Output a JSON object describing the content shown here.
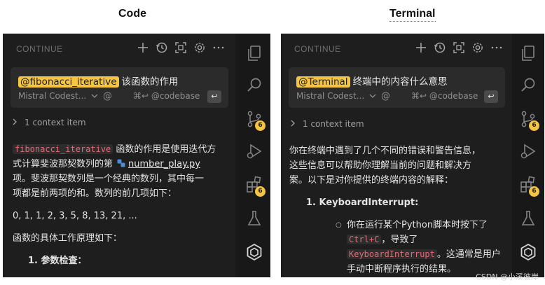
{
  "left": {
    "caption": "Code",
    "header": "CONTINUE",
    "input": {
      "mention": "@fibonacci_iterative",
      "question": "该函数的作用",
      "model": "Mistral Codest...",
      "at_label": "@",
      "codebase": "⌘↩ @codebase",
      "enter": "↩"
    },
    "context": "1 context item",
    "answer": {
      "code_term": "fibonacci_iterative",
      "line1_rest": " 函数的作用是使用迭代方",
      "line2": "式计算斐波那契数列的第",
      "file_link": "number_play.py",
      "line3": "项。斐波那契数列是一个经典的数列，其中每一",
      "line4": "项都是前两项的和。数列的前几项如下：",
      "sequence": "0, 1, 1, 2, 3, 5, 8, 13, 21, ...",
      "principle": "函数的具体工作原理如下：",
      "step1": "1. 参数检查："
    },
    "badges": [
      "6",
      "6"
    ]
  },
  "right": {
    "caption": "Terminal",
    "header": "CONTINUE",
    "input": {
      "mention": "@Terminal",
      "question": "终端中的内容什么意思",
      "model": "Mistral Codest...",
      "at_label": "@",
      "codebase": "⌘↩ @codebase",
      "enter": "↩"
    },
    "context": "1 context item",
    "answer": {
      "line1": "你在终端中遇到了几个不同的错误和警告信息，",
      "line2": "这些信息可以帮助你理解当前的问题和解决方",
      "line3": "案。以下是对你提供的终端内容的解释：",
      "item1_title": "KeyboardInterrupt",
      "item1_num": "1.",
      "item1_colon": ":",
      "bullet_line1": "你在运行某个Python脚本时按下了",
      "code1": "Ctrl+C",
      "bullet_line2_rest": "，导致了",
      "code2": "KeyboardInterrupt",
      "bullet_line3_rest": "。这通常是用户",
      "bullet_line4": "手动中断程序执行的结果。"
    },
    "badges": [
      "6",
      "6"
    ]
  },
  "watermark": "CSDN @小溪彼岸",
  "colors": {
    "mention_bg": "#f5c542",
    "badge": "#f5c542",
    "code_text": "#e06c75",
    "panel_bg": "#1e1e1e"
  }
}
